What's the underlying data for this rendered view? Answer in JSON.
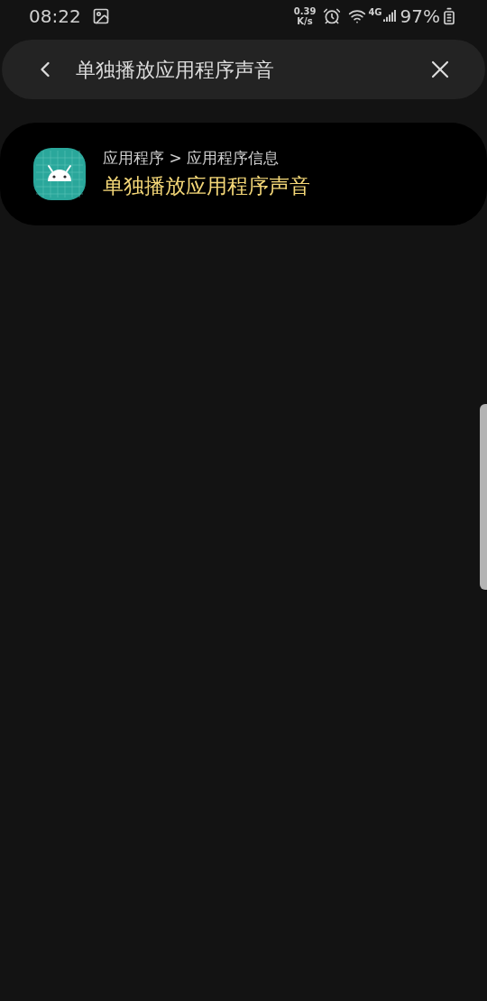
{
  "status_bar": {
    "time": "08:22",
    "speed_value": "0.39",
    "speed_unit": "K/s",
    "network": "4G",
    "battery": "97%"
  },
  "search": {
    "value": "单独播放应用程序声音"
  },
  "results": [
    {
      "path": "应用程序 > 应用程序信息",
      "title": "单独播放应用程序声音",
      "highlighted": true
    }
  ]
}
